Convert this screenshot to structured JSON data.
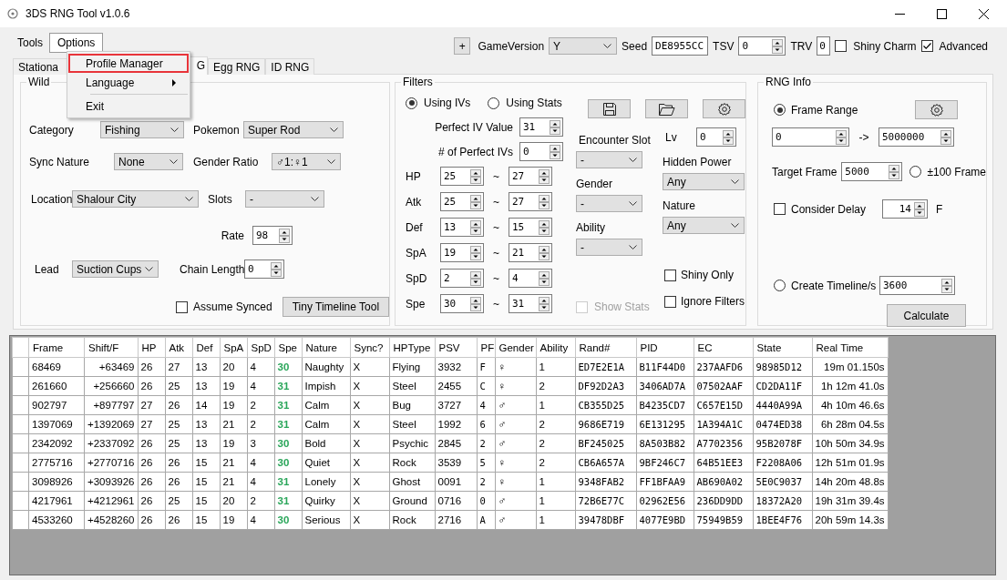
{
  "window": {
    "title": "3DS RNG Tool v1.0.6"
  },
  "menu_bar": [
    {
      "label": "Tools",
      "selected": false
    },
    {
      "label": "Options",
      "selected": true
    }
  ],
  "open_menu": [
    {
      "kind": "item",
      "label": "Profile Manager",
      "submenu": false,
      "highlighted": true
    },
    {
      "kind": "item",
      "label": "Language",
      "submenu": true,
      "highlighted": false
    },
    {
      "kind": "separator"
    },
    {
      "kind": "item",
      "label": "Exit",
      "submenu": false,
      "highlighted": false
    }
  ],
  "toolbar": {
    "add_button": "+",
    "game_version_label": "GameVersion",
    "game_version": "Y",
    "seed_label": "Seed",
    "seed": "DE8955CC",
    "tsv_label": "TSV",
    "tsv": "0",
    "trv_label": "TRV",
    "trv": "0",
    "checkboxes": [
      {
        "label": "Shiny Charm",
        "checked": false
      },
      {
        "label": "Advanced",
        "checked": true
      }
    ]
  },
  "tabs": [
    {
      "label": "Stationa",
      "selected": false
    },
    {
      "label": "G",
      "selected": true
    },
    {
      "label": "Egg RNG",
      "selected": false
    },
    {
      "label": "ID RNG",
      "selected": false
    }
  ],
  "wild": {
    "title": "Wild",
    "category": {
      "label": "Category",
      "value": "Fishing"
    },
    "pokemon": {
      "label": "Pokemon",
      "value": "Super Rod"
    },
    "sync_nature": {
      "label": "Sync Nature",
      "value": "None"
    },
    "gender_ratio": {
      "label": "Gender Ratio",
      "value": "♂1:♀1"
    },
    "location": {
      "label": "Location",
      "value": "Shalour City"
    },
    "slots": {
      "label": "Slots",
      "value": "-"
    },
    "rate": {
      "label": "Rate",
      "value": "98"
    },
    "lead": {
      "label": "Lead",
      "value": "Suction Cups"
    },
    "chain_length": {
      "label": "Chain Length",
      "value": "0"
    },
    "assume_synced": {
      "label": "Assume Synced",
      "checked": false
    },
    "tiny_timeline_button": "Tiny Timeline Tool"
  },
  "filters": {
    "title": "Filters",
    "modes": [
      {
        "label": "Using IVs",
        "selected": true
      },
      {
        "label": "Using Stats",
        "selected": false
      }
    ],
    "perfect_iv_value": {
      "label": "Perfect IV Value",
      "value": "31"
    },
    "perfect_iv_count": {
      "label": "# of Perfect IVs",
      "value": "0"
    },
    "iv_ranges": [
      {
        "stat": "HP",
        "min": "25",
        "separator": "~",
        "max": "27"
      },
      {
        "stat": "Atk",
        "min": "25",
        "separator": "~",
        "max": "27"
      },
      {
        "stat": "Def",
        "min": "13",
        "separator": "~",
        "max": "15"
      },
      {
        "stat": "SpA",
        "min": "19",
        "separator": "~",
        "max": "21"
      },
      {
        "stat": "SpD",
        "min": "2",
        "separator": "~",
        "max": "4"
      },
      {
        "stat": "Spe",
        "min": "30",
        "separator": "~",
        "max": "31"
      }
    ],
    "encounter_slot": {
      "label": "Encounter Slot",
      "value": "-"
    },
    "gender": {
      "label": "Gender",
      "value": "-"
    },
    "ability": {
      "label": "Ability",
      "value": "-"
    },
    "lv": {
      "label": "Lv",
      "value": "0"
    },
    "hidden_power": {
      "label": "Hidden Power",
      "value": "Any"
    },
    "nature": {
      "label": "Nature",
      "value": "Any"
    },
    "show_stats": {
      "label": "Show Stats",
      "checked": false,
      "disabled": true
    },
    "shiny_only": {
      "label": "Shiny Only",
      "checked": false
    },
    "ignore_filters": {
      "label": "Ignore Filters",
      "checked": false
    }
  },
  "rng_info": {
    "title": "RNG Info",
    "frame_range": {
      "label": "Frame Range",
      "selected": true,
      "from": "0",
      "arrow": "->",
      "to": "5000000"
    },
    "target_frame": {
      "label": "Target Frame",
      "value": "5000"
    },
    "plus_minus": {
      "label": "±100 Frame",
      "selected": false
    },
    "consider_delay": {
      "label": "Consider Delay",
      "checked": false,
      "value": "14",
      "unit": "F"
    },
    "create_timeline": {
      "label": "Create Timeline/s",
      "selected": false,
      "value": "3600"
    },
    "calculate_button": "Calculate"
  },
  "table": {
    "columns": [
      {
        "label": "Frame",
        "kind": "text"
      },
      {
        "label": "Shift/F",
        "kind": "right"
      },
      {
        "label": "HP",
        "kind": "text"
      },
      {
        "label": "Atk",
        "kind": "text"
      },
      {
        "label": "Def",
        "kind": "text"
      },
      {
        "label": "SpA",
        "kind": "text"
      },
      {
        "label": "SpD",
        "kind": "text"
      },
      {
        "label": "Spe",
        "kind": "highlight"
      },
      {
        "label": "Nature",
        "kind": "text"
      },
      {
        "label": "Sync?",
        "kind": "text"
      },
      {
        "label": "HPType",
        "kind": "text"
      },
      {
        "label": "PSV",
        "kind": "text"
      },
      {
        "label": "PF",
        "kind": "mono"
      },
      {
        "label": "Gender",
        "kind": "text"
      },
      {
        "label": "Ability",
        "kind": "text"
      },
      {
        "label": "Rand#",
        "kind": "mono"
      },
      {
        "label": "PID",
        "kind": "mono"
      },
      {
        "label": "EC",
        "kind": "mono"
      },
      {
        "label": "State",
        "kind": "mono"
      },
      {
        "label": "Real Time",
        "kind": "right"
      }
    ],
    "rows": [
      [
        "68469",
        "+63469",
        "26",
        "27",
        "13",
        "20",
        "4",
        "30",
        "Naughty",
        "X",
        "Flying",
        "3932",
        "F",
        "♀",
        "1",
        "ED7E2E1A",
        "B11F44D0",
        "237AAFD6",
        "98985D12",
        "19m 01.150s"
      ],
      [
        "261660",
        "+256660",
        "26",
        "25",
        "13",
        "19",
        "4",
        "31",
        "Impish",
        "X",
        "Steel",
        "2455",
        "C",
        "♀",
        "2",
        "DF92D2A3",
        "3406AD7A",
        "07502AAF",
        "CD2DA11F",
        "1h 12m 41.0s"
      ],
      [
        "902797",
        "+897797",
        "27",
        "26",
        "14",
        "19",
        "2",
        "31",
        "Calm",
        "X",
        "Bug",
        "3727",
        "4",
        "♂",
        "1",
        "CB355D25",
        "B4235CD7",
        "C657E15D",
        "4440A99A",
        "4h 10m 46.6s"
      ],
      [
        "1397069",
        "+1392069",
        "27",
        "25",
        "13",
        "21",
        "2",
        "31",
        "Calm",
        "X",
        "Steel",
        "1992",
        "6",
        "♂",
        "2",
        "9686E719",
        "6E131295",
        "1A394A1C",
        "0474ED38",
        "6h 28m 04.5s"
      ],
      [
        "2342092",
        "+2337092",
        "26",
        "25",
        "13",
        "19",
        "3",
        "30",
        "Bold",
        "X",
        "Psychic",
        "2845",
        "2",
        "♂",
        "2",
        "BF245025",
        "8A503B82",
        "A7702356",
        "95B2078F",
        "10h 50m 34.9s"
      ],
      [
        "2775716",
        "+2770716",
        "26",
        "26",
        "15",
        "21",
        "4",
        "30",
        "Quiet",
        "X",
        "Rock",
        "3539",
        "5",
        "♀",
        "2",
        "CB6A657A",
        "9BF246C7",
        "64B51EE3",
        "F2208A06",
        "12h 51m 01.9s"
      ],
      [
        "3098926",
        "+3093926",
        "26",
        "26",
        "15",
        "21",
        "4",
        "31",
        "Lonely",
        "X",
        "Ghost",
        "0091",
        "2",
        "♀",
        "1",
        "9348FAB2",
        "FF1BFAA9",
        "AB690A02",
        "5E0C9037",
        "14h 20m 48.8s"
      ],
      [
        "4217961",
        "+4212961",
        "26",
        "25",
        "15",
        "20",
        "2",
        "31",
        "Quirky",
        "X",
        "Ground",
        "0716",
        "0",
        "♂",
        "1",
        "72B6E77C",
        "02962E56",
        "236DD9DD",
        "18372A20",
        "19h 31m 39.4s"
      ],
      [
        "4533260",
        "+4528260",
        "26",
        "26",
        "15",
        "19",
        "4",
        "30",
        "Serious",
        "X",
        "Rock",
        "2716",
        "A",
        "♂",
        "1",
        "39478DBF",
        "4077E9BD",
        "75949B59",
        "1BEE4F76",
        "20h 59m 14.3s"
      ]
    ]
  }
}
